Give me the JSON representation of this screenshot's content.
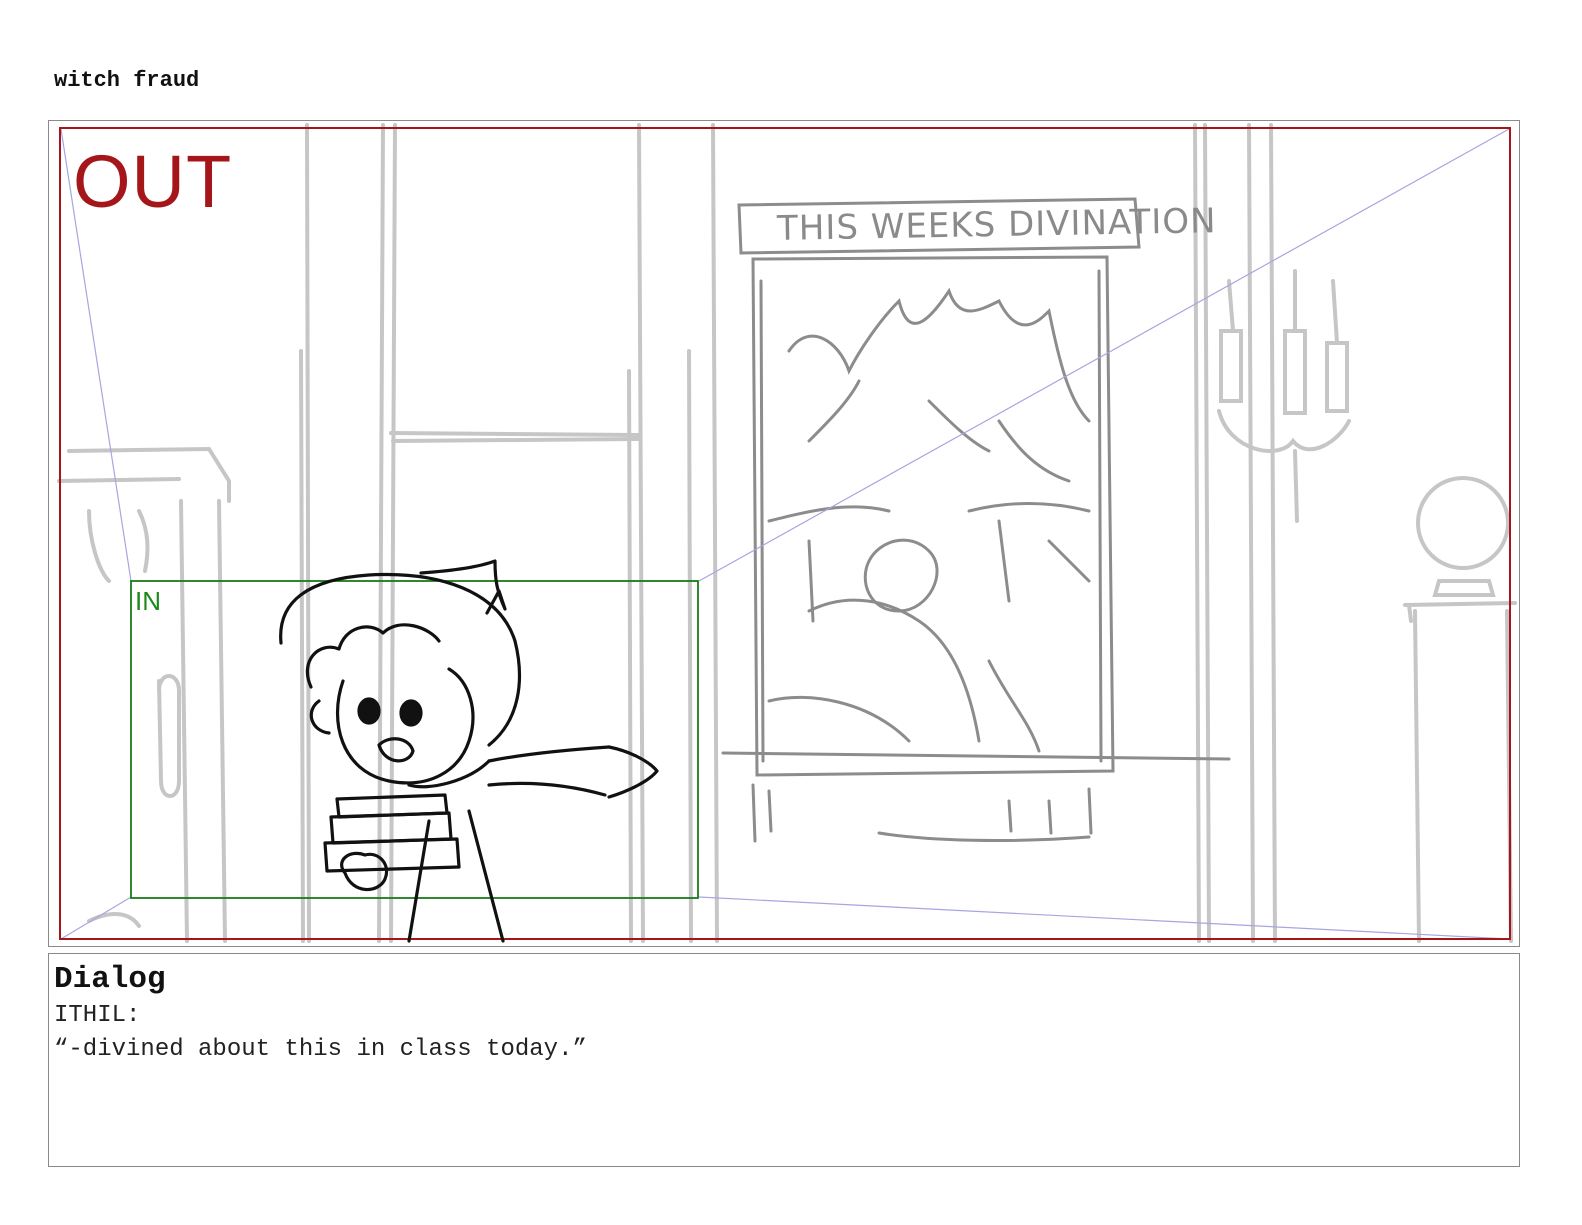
{
  "board": {
    "title": "witch fraud"
  },
  "panel": {
    "out_label": "OUT",
    "in_label": "IN",
    "poster_title": "THIS WEEKS DIVINATION",
    "colors": {
      "out_frame": "#a4161a",
      "in_frame": "#1a7a1a",
      "camera_guides": "#9999dd",
      "background_sketch": "#c4c4c4",
      "character_ink": "#111111"
    }
  },
  "dialog": {
    "heading": "Dialog",
    "speaker": "ITHIL:",
    "line": "“-divined about this in class today.”"
  }
}
